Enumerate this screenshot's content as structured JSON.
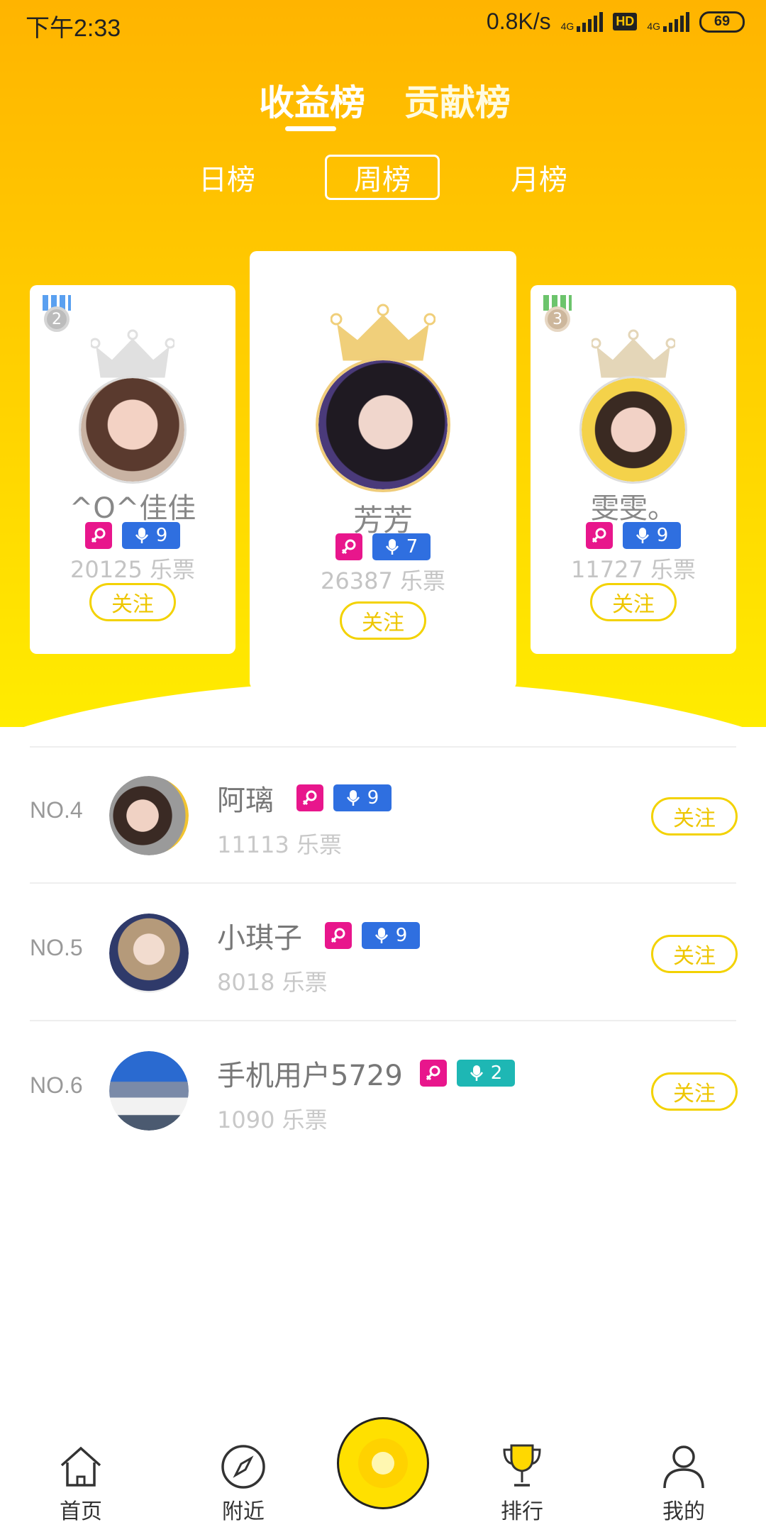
{
  "status_bar": {
    "time": "下午2:33",
    "speed": "0.8K/s",
    "net1": "4G",
    "hd": "HD",
    "net2": "4G",
    "battery": "69"
  },
  "main_tabs": [
    {
      "label": "收益榜",
      "active": true
    },
    {
      "label": "贡献榜",
      "active": false
    }
  ],
  "period_tabs": [
    {
      "label": "日榜",
      "active": false
    },
    {
      "label": "周榜",
      "active": true
    },
    {
      "label": "月榜",
      "active": false
    }
  ],
  "podium": [
    {
      "rank": "2",
      "name": "^O^佳佳",
      "level": "9",
      "level_color": "blue",
      "score": "20125 乐票",
      "follow": "关注"
    },
    {
      "rank": "1",
      "name": "芳芳",
      "level": "7",
      "level_color": "blue",
      "score": "26387 乐票",
      "follow": "关注"
    },
    {
      "rank": "3",
      "name": "雯雯。",
      "level": "9",
      "level_color": "blue",
      "score": "11727 乐票",
      "follow": "关注"
    }
  ],
  "list": [
    {
      "rank": "NO.4",
      "name": "阿璃",
      "level": "9",
      "level_color": "blue",
      "score": "11113 乐票",
      "follow": "关注"
    },
    {
      "rank": "NO.5",
      "name": "小琪子",
      "level": "9",
      "level_color": "blue",
      "score": "8018 乐票",
      "follow": "关注"
    },
    {
      "rank": "NO.6",
      "name": "手机用户5729",
      "level": "2",
      "level_color": "teal",
      "score": "1090 乐票",
      "follow": "关注"
    }
  ],
  "bottom_nav": [
    {
      "label": "首页",
      "icon": "home-icon"
    },
    {
      "label": "附近",
      "icon": "compass-icon"
    },
    {
      "label": "",
      "icon": "record-icon"
    },
    {
      "label": "排行",
      "icon": "trophy-icon"
    },
    {
      "label": "我的",
      "icon": "user-icon"
    }
  ],
  "colors": {
    "accent": "#ffd200",
    "gold_top": "#ffb400",
    "gender_badge": "#e8168c",
    "level_blue": "#2f6fe0",
    "level_teal": "#1eb7b4",
    "follow": "#eec600"
  }
}
